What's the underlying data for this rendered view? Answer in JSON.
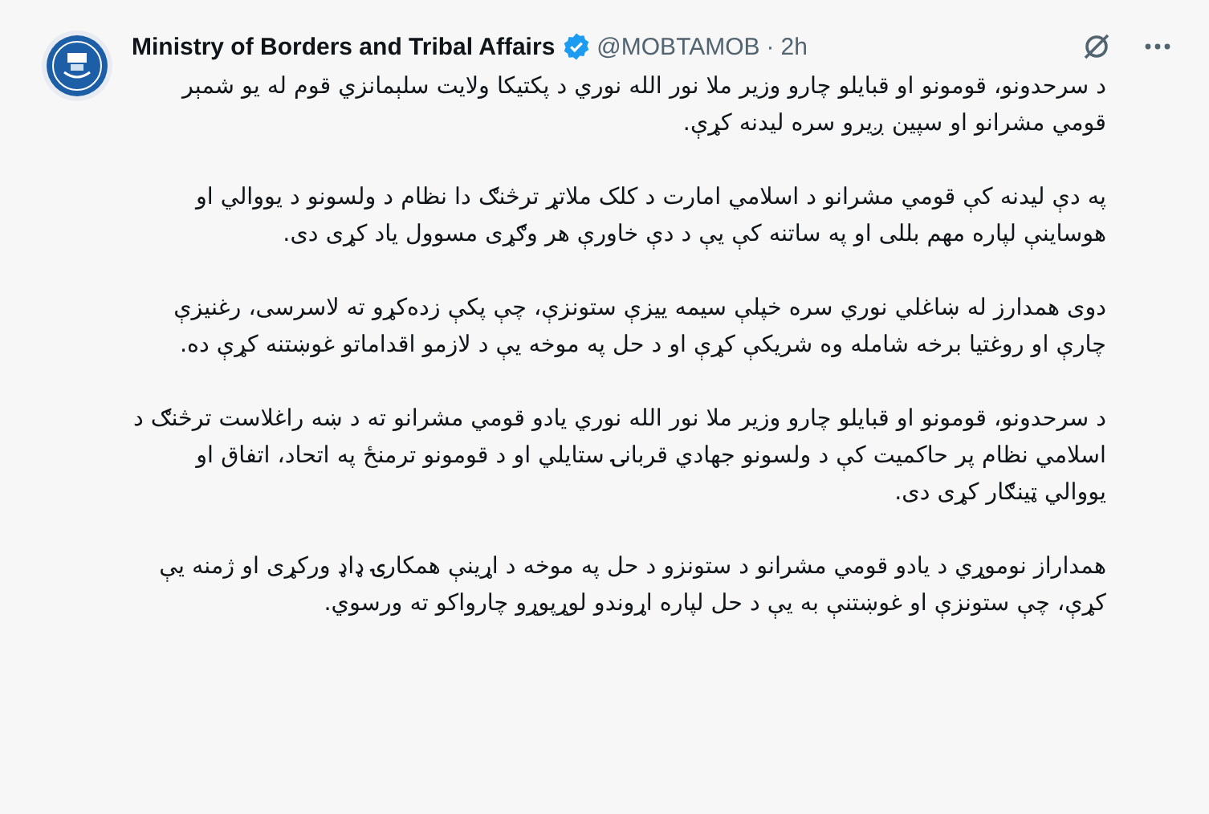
{
  "post": {
    "author": {
      "name": "Ministry of Borders and Tribal Affairs",
      "verified": true,
      "handle": "@MOBTAMOB",
      "separator": "·",
      "time": "2h"
    },
    "paragraphs": [
      "د سرحدونو، قومونو او قبايلو چارو وزير ملا نور الله نوري د پکتيکا ولايت سلېمانزي قوم له يو شمېر قومي مشرانو او سپين ږيرو سره ليدنه کړې.",
      "په دې ليدنه کې قومي مشرانو د اسلامي امارت د کلک ملاتړ ترڅنګ دا نظام د ولسونو د يووالي او هوساينې لپاره مهم بللی او په ساتنه کې يې د دې خاورې هر وګړی مسوول ياد کړی دی.",
      "دوی همدارز له ښاغلي نوري سره خپلې سيمه ييزې ستونزې، چې پکې زده‌کړو ته لاسرسی، رغنيزې چارې او روغتيا برخه شامله وه شريکې کړې او د حل په موخه يې د لازمو اقداماتو غوښتنه کړې ده.",
      "د سرحدونو، قومونو او قبايلو چارو وزير ملا نور الله نوري يادو قومي مشرانو ته د ښه راغلاست ترڅنګ د اسلامي نظام پر حاکميت کې د ولسونو جهادي قربانۍ ستايلي او د قومونو ترمنځ په اتحاد، اتفاق او يووالي ټينګار کړی دی.",
      "همداراز نوموړي د يادو قومي مشرانو د ستونزو د حل په موخه د اړينې همکارۍ ډاډ ورکړی او ژمنه يې کړې، چې ستونزې او غوښتنې به يې د حل لپاره اړوندو لوړپوړو چارواکو ته ورسوي."
    ]
  }
}
